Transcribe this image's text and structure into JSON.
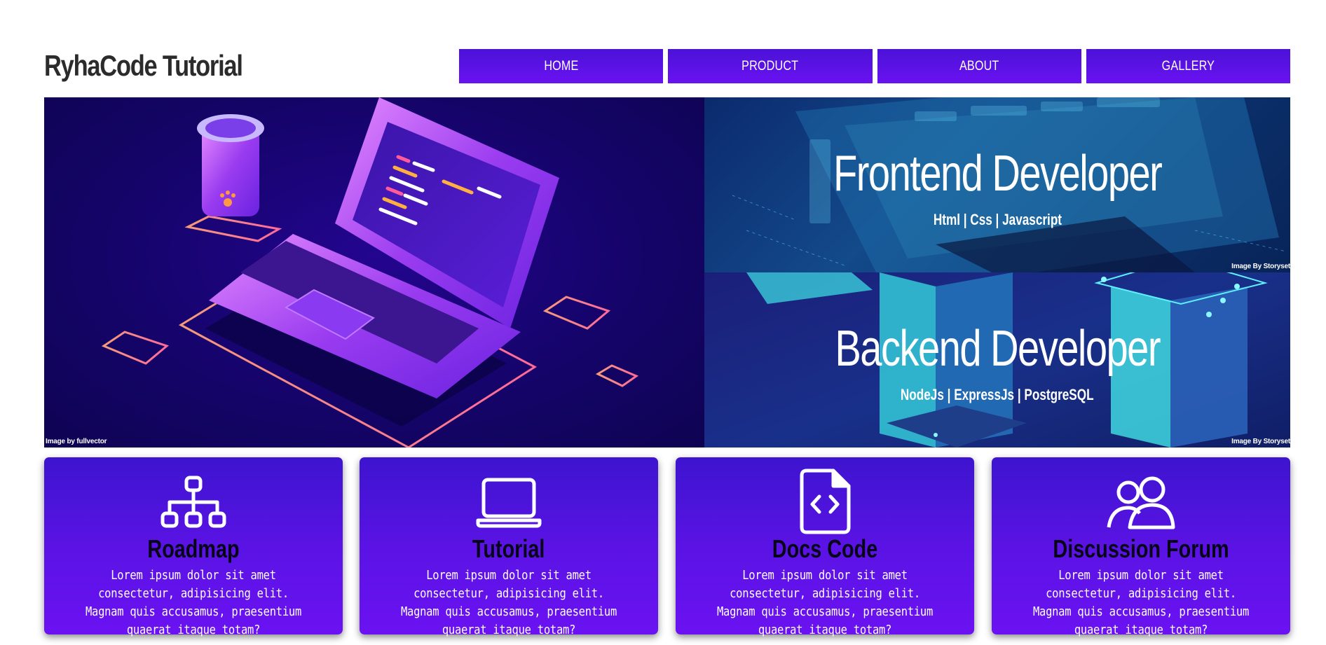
{
  "header": {
    "logo": "RyhaCode Tutorial"
  },
  "nav": {
    "items": [
      "HOME",
      "PRODUCT",
      "ABOUT",
      "GALLERY"
    ]
  },
  "hero": {
    "left_credit": "Image by fullvector",
    "panels": [
      {
        "title": "Frontend Developer",
        "subtitle": "Html | Css | Javascript",
        "credit": "Image By Storyset"
      },
      {
        "title": "Backend Developer",
        "subtitle": "NodeJs | ExpressJs | PostgreSQL",
        "credit": "Image By Storyset"
      }
    ]
  },
  "cards": [
    {
      "icon": "sitemap-icon",
      "title": "Roadmap",
      "text": "Lorem ipsum dolor sit amet consectetur, adipisicing elit. Magnam quis accusamus, praesentium quaerat itaque totam?"
    },
    {
      "icon": "laptop-icon",
      "title": "Tutorial",
      "text": "Lorem ipsum dolor sit amet consectetur, adipisicing elit. Magnam quis accusamus, praesentium quaerat itaque totam?"
    },
    {
      "icon": "code-file-icon",
      "title": "Docs Code",
      "text": "Lorem ipsum dolor sit amet consectetur, adipisicing elit. Magnam quis accusamus, praesentium quaerat itaque totam?"
    },
    {
      "icon": "users-icon",
      "title": "Discussion Forum",
      "text": "Lorem ipsum dolor sit amet consectetur, adipisicing elit. Magnam quis accusamus, praesentium quaerat itaque totam?"
    }
  ],
  "colors": {
    "accent": "#5a13e4",
    "nav": "#5a12e6",
    "hero_dark": "#15046a"
  }
}
